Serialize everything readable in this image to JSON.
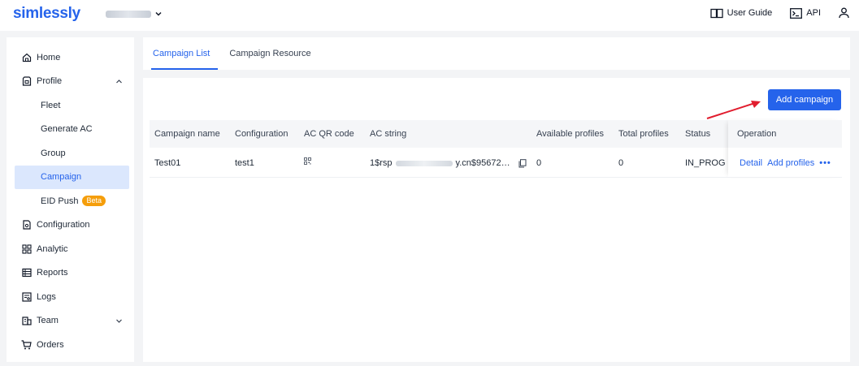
{
  "header": {
    "logo": "simlessly",
    "user_guide": "User Guide",
    "api": "API"
  },
  "sidebar": {
    "items": [
      {
        "label": "Home",
        "icon": "home-icon"
      },
      {
        "label": "Profile",
        "icon": "profile-icon"
      },
      {
        "label": "Fleet"
      },
      {
        "label": "Generate AC"
      },
      {
        "label": "Group"
      },
      {
        "label": "Campaign"
      },
      {
        "label": "EID Push",
        "badge": "Beta"
      },
      {
        "label": "Configuration",
        "icon": "configuration-icon"
      },
      {
        "label": "Analytic",
        "icon": "analytic-icon"
      },
      {
        "label": "Reports",
        "icon": "reports-icon"
      },
      {
        "label": "Logs",
        "icon": "logs-icon"
      },
      {
        "label": "Team",
        "icon": "team-icon"
      },
      {
        "label": "Orders",
        "icon": "cart-icon"
      }
    ]
  },
  "tabs": [
    {
      "label": "Campaign List",
      "active": true
    },
    {
      "label": "Campaign Resource",
      "active": false
    }
  ],
  "main": {
    "add_button": "Add campaign",
    "columns": [
      "Campaign name",
      "Configuration",
      "AC QR code",
      "AC string",
      "Available profiles",
      "Total profiles",
      "Status",
      "Operation"
    ],
    "rows": [
      {
        "campaign_name": "Test01",
        "configuration": "test1",
        "ac_string_start": "1$rsp",
        "ac_string_end": "y.cn$95672…",
        "available_profiles": "0",
        "total_profiles": "0",
        "status": "IN_PROGR",
        "op_detail": "Detail",
        "op_add": "Add profiles",
        "op_more": "•••"
      }
    ]
  },
  "colors": {
    "accent": "#2563eb",
    "beta": "#f59e0b",
    "arrow": "#e11d2e"
  }
}
